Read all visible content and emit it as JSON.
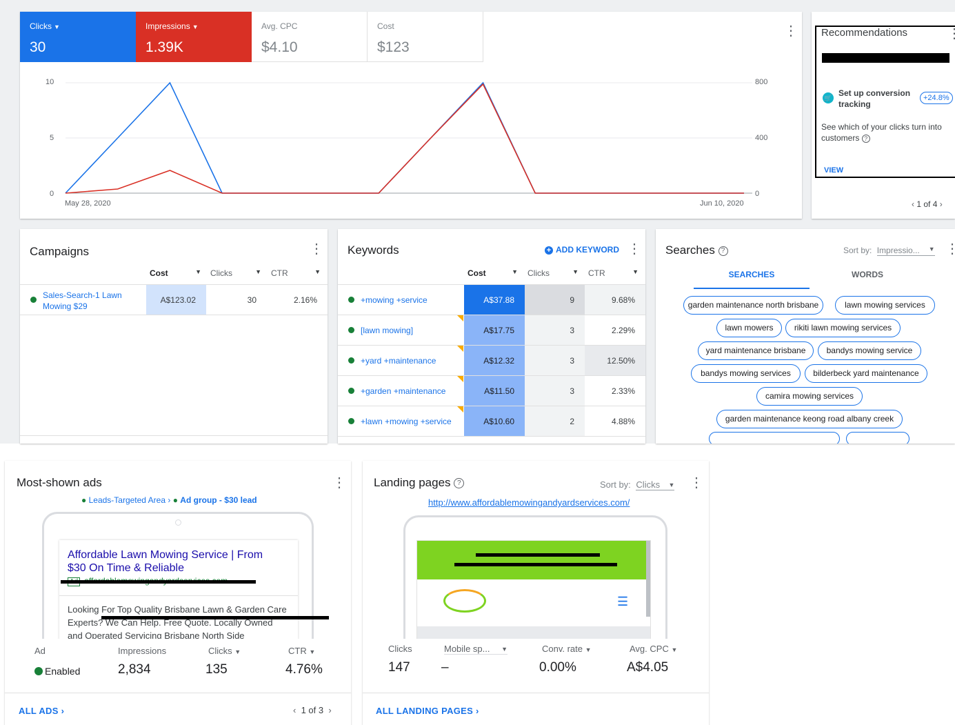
{
  "colors": {
    "blue": "#1a73e8",
    "red": "#d93025",
    "green": "#188038"
  },
  "metrics": [
    {
      "label": "Clicks",
      "value": "30",
      "color": "#1a73e8",
      "dropdown": true
    },
    {
      "label": "Impressions",
      "value": "1.39K",
      "color": "#d93025",
      "dropdown": true
    },
    {
      "label": "Avg. CPC",
      "value": "$4.10",
      "color": "",
      "dropdown": false
    },
    {
      "label": "Cost",
      "value": "$123",
      "color": "",
      "dropdown": false
    }
  ],
  "chart_data": {
    "type": "line",
    "x_start": "May 28, 2020",
    "x_end": "Jun 10, 2020",
    "y_left_ticks": [
      "10",
      "5",
      "0"
    ],
    "y_right_ticks": [
      "800",
      "400",
      "0"
    ],
    "ylim_left": [
      0,
      10
    ],
    "ylim_right": [
      0,
      800
    ],
    "series": [
      {
        "name": "Clicks",
        "axis": "left",
        "values": [
          0,
          5,
          10,
          0,
          0,
          0,
          0,
          5,
          10,
          0,
          0,
          0,
          0,
          0
        ]
      },
      {
        "name": "Impressions",
        "axis": "right",
        "values": [
          0,
          30,
          165,
          0,
          0,
          0,
          0,
          400,
          790,
          0,
          0,
          0,
          0,
          0
        ]
      }
    ]
  },
  "recommendations": {
    "title": "Recommendations",
    "item_title": "Set up conversion tracking",
    "badge": "+24.8%",
    "description": "See which of your clicks turn into customers",
    "view": "VIEW",
    "pager": "1 of 4"
  },
  "campaigns": {
    "title": "Campaigns",
    "headers": [
      "Cost",
      "Clicks",
      "CTR"
    ],
    "rows": [
      {
        "name": "Sales-Search-1 Lawn Mowing $29",
        "cost": "A$123.02",
        "clicks": "30",
        "ctr": "2.16%"
      }
    ]
  },
  "keywords": {
    "title": "Keywords",
    "add": "ADD KEYWORD",
    "headers": [
      "Cost",
      "Clicks",
      "CTR"
    ],
    "rows": [
      {
        "kw": "+mowing +service",
        "cost": "A$37.88",
        "clicks": "9",
        "ctr": "9.68%"
      },
      {
        "kw": "[lawn mowing]",
        "cost": "A$17.75",
        "clicks": "3",
        "ctr": "2.29%"
      },
      {
        "kw": "+yard +maintenance",
        "cost": "A$12.32",
        "clicks": "3",
        "ctr": "12.50%"
      },
      {
        "kw": "+garden +maintenance",
        "cost": "A$11.50",
        "clicks": "3",
        "ctr": "2.33%"
      },
      {
        "kw": "+lawn +mowing +service",
        "cost": "A$10.60",
        "clicks": "2",
        "ctr": "4.88%"
      }
    ]
  },
  "searches": {
    "title": "Searches",
    "sort_label": "Sort by:",
    "sort_value": "Impressio...",
    "tabs": [
      "SEARCHES",
      "WORDS"
    ],
    "chips": [
      "garden maintenance north brisbane",
      "lawn mowing services",
      "lawn mowers",
      "rikiti lawn mowing services",
      "yard maintenance brisbane",
      "bandys mowing service",
      "bandys mowing services",
      "bilderbeck yard maintenance",
      "camira mowing services",
      "garden maintenance keong road albany creek"
    ]
  },
  "ads": {
    "title": "Most-shown ads",
    "crumb1": "Leads-Targeted Area",
    "crumb2": "Ad group - $30 lead",
    "headline": "Affordable Lawn Mowing Service | From $30 On Time & Reliable",
    "url": "affordablemowingandyardservices.com",
    "ad_badge": "Ad",
    "body": "Looking For Top Quality Brisbane Lawn & Garden Care Experts? We Can Help. Free Quote. Locally Owned and Operated Servicing Brisbane North Side",
    "cols": [
      "Ad",
      "Impressions",
      "Clicks",
      "CTR"
    ],
    "status": "Enabled",
    "impressions": "2,834",
    "clicks": "135",
    "ctr": "4.76%",
    "all": "ALL ADS",
    "pager": "1 of 3"
  },
  "landing": {
    "title": "Landing pages",
    "sort_label": "Sort by:",
    "sort_value": "Clicks",
    "url": "http://www.affordablemowingandyardservices.com/",
    "cols": [
      "Clicks",
      "Mobile sp...",
      "Conv. rate",
      "Avg. CPC"
    ],
    "clicks": "147",
    "mobile": "–",
    "conv": "0.00%",
    "cpc": "A$4.05",
    "all": "ALL LANDING PAGES"
  }
}
